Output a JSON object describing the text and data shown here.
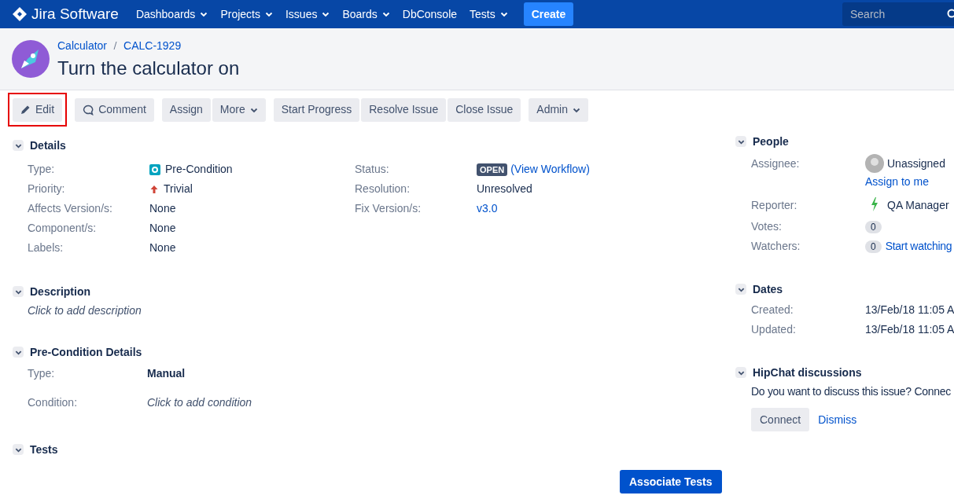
{
  "nav": {
    "logo": "Jira Software",
    "menus": [
      {
        "label": "Dashboards",
        "dropdown": true
      },
      {
        "label": "Projects",
        "dropdown": true
      },
      {
        "label": "Issues",
        "dropdown": true
      },
      {
        "label": "Boards",
        "dropdown": true
      },
      {
        "label": "DbConsole",
        "dropdown": false
      },
      {
        "label": "Tests",
        "dropdown": true
      }
    ],
    "create": "Create",
    "search": {
      "placeholder": "Search"
    }
  },
  "breadcrumb": [
    "Calculator",
    "CALC-1929"
  ],
  "title": "Turn the calculator on",
  "toolbar": [
    [
      {
        "label": "Edit",
        "kind": "edit",
        "dropdown": false,
        "highlighted": true
      }
    ],
    [
      {
        "label": "Comment",
        "kind": "comment",
        "dropdown": false,
        "highlighted": false
      }
    ],
    [
      {
        "label": "Assign",
        "kind": "plain",
        "dropdown": false,
        "highlighted": false
      },
      {
        "label": "More",
        "kind": "plain",
        "dropdown": true,
        "highlighted": false
      }
    ],
    [
      {
        "label": "Start Progress",
        "kind": "plain",
        "dropdown": false,
        "highlighted": false
      },
      {
        "label": "Resolve Issue",
        "kind": "plain",
        "dropdown": false,
        "highlighted": false
      },
      {
        "label": "Close Issue",
        "kind": "plain",
        "dropdown": false,
        "highlighted": false
      }
    ],
    [
      {
        "label": "Admin",
        "kind": "plain",
        "dropdown": true,
        "highlighted": false
      }
    ]
  ],
  "details": {
    "title": "Details",
    "expanded": true,
    "left": [
      {
        "label": "Type:",
        "value": "Pre-Condition",
        "kind": "type"
      },
      {
        "label": "Priority:",
        "value": "Trivial",
        "kind": "priority"
      },
      {
        "label": "Affects Version/s:",
        "value": "None",
        "kind": "text"
      },
      {
        "label": "Component/s:",
        "value": "None",
        "kind": "text"
      },
      {
        "label": "Labels:",
        "value": "None",
        "kind": "text"
      }
    ],
    "right": [
      {
        "label": "Status:",
        "value": "OPEN",
        "link": "(View Workflow)",
        "kind": "status"
      },
      {
        "label": "Resolution:",
        "value": "Unresolved",
        "kind": "text"
      },
      {
        "label": "Fix Version/s:",
        "value": "v3.0",
        "kind": "link"
      }
    ]
  },
  "description": {
    "title": "Description",
    "expanded": true,
    "placeholder": "Click to add description"
  },
  "precondition": {
    "title": "Pre-Condition Details",
    "expanded": true,
    "type_label": "Type:",
    "type_value": "Manual",
    "condition_label": "Condition:",
    "condition_placeholder": "Click to add condition"
  },
  "tests": {
    "title": "Tests",
    "expanded": true,
    "button": "Associate Tests"
  },
  "people": {
    "title": "People",
    "expanded": true,
    "assignee_label": "Assignee:",
    "assignee": "Unassigned",
    "assign_link": "Assign to me",
    "reporter_label": "Reporter:",
    "reporter": "QA Manager",
    "votes_label": "Votes:",
    "votes": "0",
    "watchers_label": "Watchers:",
    "watchers": "0",
    "watch_link": "Start watching"
  },
  "dates": {
    "title": "Dates",
    "expanded": true,
    "rows": [
      {
        "label": "Created:",
        "value": "13/Feb/18 11:05 A"
      },
      {
        "label": "Updated:",
        "value": "13/Feb/18 11:05 A"
      }
    ]
  },
  "hipchat": {
    "title": "HipChat discussions",
    "expanded": true,
    "text": "Do you want to discuss this issue? Connec",
    "connect": "Connect",
    "dismiss": "Dismiss"
  }
}
